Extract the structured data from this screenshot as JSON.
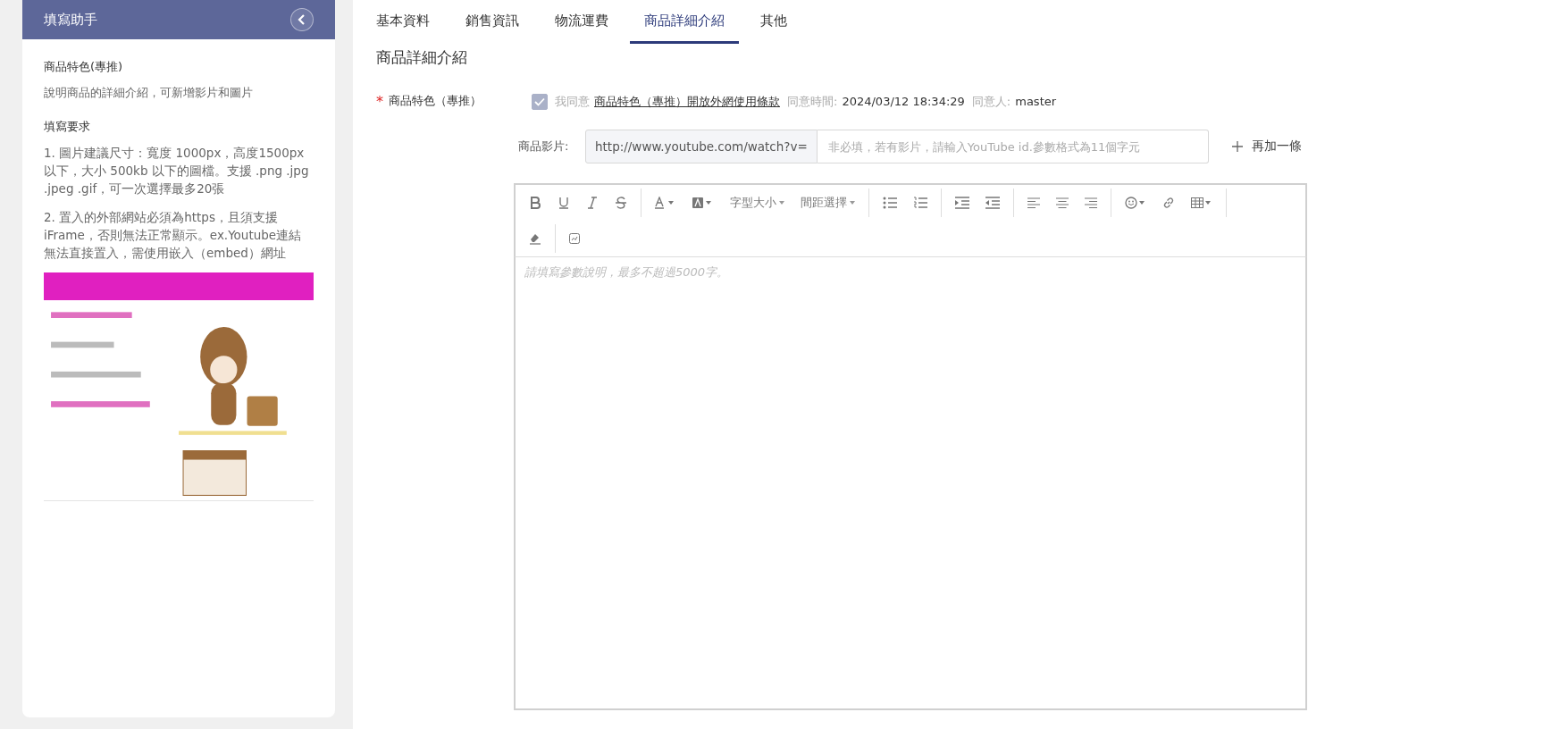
{
  "helper": {
    "title": "填寫助手",
    "section_title": "商品特色(專推)",
    "section_desc": "說明商品的詳細介紹，可新增影片和圖片",
    "req_title": "填寫要求",
    "requirements": [
      "1. 圖片建議尺寸：寬度 1000px，高度1500px以下，大小 500kb 以下的圖檔。支援 .png .jpg .jpeg .gif，可一次選擇最多20張",
      "2. 置入的外部網站必須為https，且須支援iFrame，否則無法正常顯示。ex.Youtube連結無法直接置入，需使用嵌入（embed）網址"
    ]
  },
  "tabs": [
    {
      "label": "基本資料",
      "selected": false
    },
    {
      "label": "銷售資訊",
      "selected": false
    },
    {
      "label": "物流運費",
      "selected": false
    },
    {
      "label": "商品詳細介紹",
      "selected": true
    },
    {
      "label": "其他",
      "selected": false
    }
  ],
  "section_heading": "商品詳細介紹",
  "feature": {
    "label": "商品特色（專推）",
    "required_mark": "*",
    "checked": true,
    "agree_text": "我同意",
    "terms_link": "商品特色（專推）開放外網使用條款",
    "time_label": "同意時間:",
    "time_value": "2024/03/12 18:34:29",
    "person_label": "同意人:",
    "person_value": "master"
  },
  "video": {
    "label": "商品影片:",
    "prefix": "http://www.youtube.com/watch?v=",
    "placeholder": "非必填，若有影片，請輸入YouTube id.參數格式為11個字元",
    "add_label": "再加一條"
  },
  "editor": {
    "font_size_menu": "字型大小",
    "spacing_menu": "間距選擇",
    "placeholder": "請填寫參數說明，最多不超過5000字。"
  }
}
